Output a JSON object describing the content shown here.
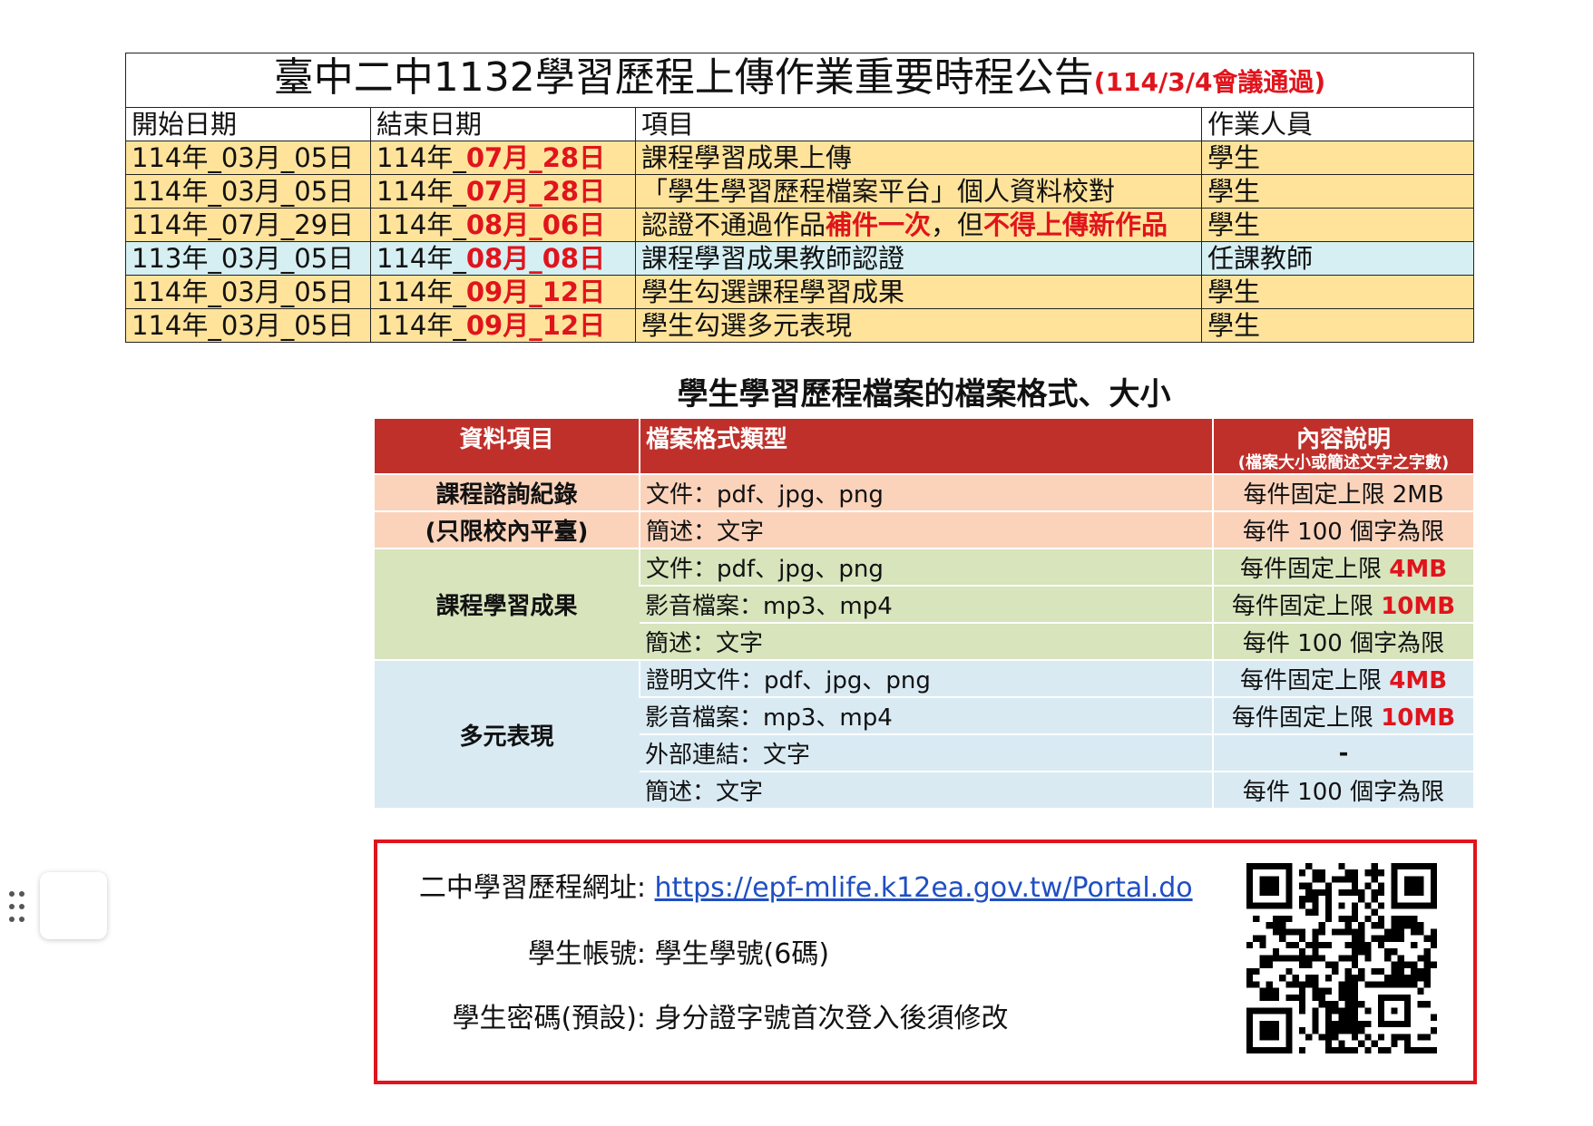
{
  "schedule": {
    "title_main": "臺中二中1132學習歷程上傳作業重要時程公告",
    "title_note": "(114/3/4會議通過)",
    "headers": [
      "開始日期",
      "結束日期",
      "項目",
      "作業人員"
    ],
    "rows": [
      {
        "start": "114年_03月_05日",
        "end_prefix": "114年_",
        "end_highlight": "07月_28日",
        "item_parts": [
          "課程學習成果上傳"
        ],
        "staff": "學生"
      },
      {
        "start": "114年_03月_05日",
        "end_prefix": "114年_",
        "end_highlight": "07月_28日",
        "item_parts": [
          "「學生學習歷程檔案平台」個人資料校對"
        ],
        "staff": "學生"
      },
      {
        "start": "114年_07月_29日",
        "end_prefix": "114年_",
        "end_highlight": "08月_06日",
        "item_parts": [
          "認證不通過作品",
          "補件一次",
          "，但",
          "不得上傳新作品"
        ],
        "staff": "學生"
      },
      {
        "start": "113年_03月_05日",
        "end_prefix": "114年_",
        "end_highlight": "08月_08日",
        "item_parts": [
          "課程學習成果教師認證"
        ],
        "staff": "任課教師"
      },
      {
        "start": "114年_03月_05日",
        "end_prefix": "114年_",
        "end_highlight": "09月_12日",
        "item_parts": [
          "學生勾選課程學習成果"
        ],
        "staff": "學生"
      },
      {
        "start": "114年_03月_05日",
        "end_prefix": "114年_",
        "end_highlight": "09月_12日",
        "item_parts": [
          "學生勾選多元表現"
        ],
        "staff": "學生"
      }
    ],
    "colors": {
      "yellow": "#ffe39a",
      "blue": "#d6eff3",
      "highlight": "#e0141c"
    }
  },
  "format": {
    "title": "學生學習歷程檔案的檔案格式、大小",
    "headers": {
      "item": "資料項目",
      "type": "檔案格式類型",
      "desc": "內容說明",
      "desc_sub": "(檔案大小或簡述文字之字數)"
    },
    "groups": [
      {
        "category_lines": [
          "課程諮詢紀錄",
          "(只限校內平臺)"
        ],
        "color": "#fbd3bb",
        "rows": [
          {
            "type": "文件：pdf、jpg、png",
            "limit_text": "每件固定上限 2MB",
            "limit_highlight": ""
          },
          {
            "type": "簡述：文字",
            "limit_text": "每件 100 個字為限",
            "limit_highlight": ""
          }
        ]
      },
      {
        "category_lines": [
          "課程學習成果"
        ],
        "color": "#d7e4bc",
        "rows": [
          {
            "type": "文件：pdf、jpg、png",
            "limit_text": "每件固定上限 ",
            "limit_highlight": "4MB"
          },
          {
            "type": "影音檔案：mp3、mp4",
            "limit_text": "每件固定上限 ",
            "limit_highlight": "10MB"
          },
          {
            "type": "簡述：文字",
            "limit_text": "每件 100 個字為限",
            "limit_highlight": ""
          }
        ]
      },
      {
        "category_lines": [
          "多元表現"
        ],
        "color": "#d9eaf3",
        "rows": [
          {
            "type": "證明文件：pdf、jpg、png",
            "limit_text": "每件固定上限 ",
            "limit_highlight": "4MB"
          },
          {
            "type": "影音檔案：mp3、mp4",
            "limit_text": "每件固定上限 ",
            "limit_highlight": "10MB"
          },
          {
            "type": "外部連結：文字",
            "limit_text": "",
            "limit_highlight": "-"
          },
          {
            "type": "簡述：文字",
            "limit_text": "每件 100 個字為限",
            "limit_highlight": ""
          }
        ]
      }
    ],
    "header_color": "#c0302b"
  },
  "info": {
    "url_label": "二中學習歷程網址:",
    "url": "https://epf-mlife.k12ea.gov.tw/Portal.do",
    "account_label": "學生帳號:",
    "account_value": "學生學號(6碼)",
    "password_label": "學生密碼(預設):",
    "password_value": "身分證字號首次登入後須修改",
    "qr_icon": "qr-code-icon",
    "border_color": "#e0141c"
  },
  "side": {
    "handle_icon": "drag-handle-icon"
  }
}
